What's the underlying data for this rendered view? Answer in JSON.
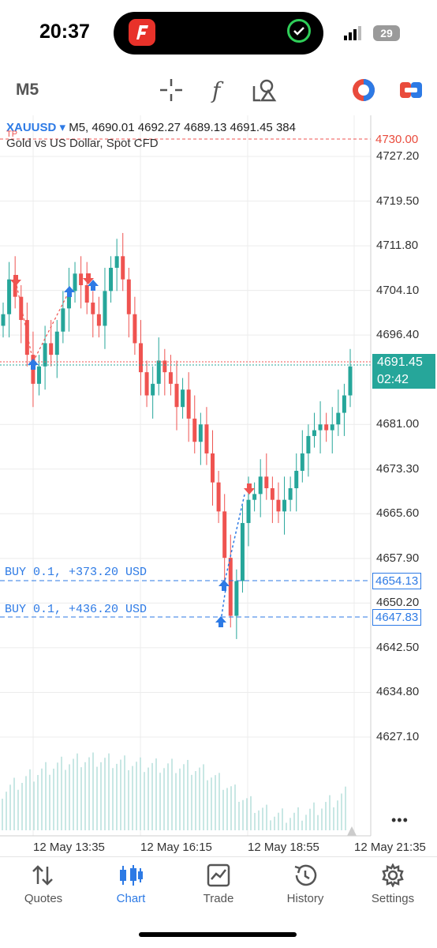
{
  "status_bar": {
    "time": "20:37",
    "battery": "29"
  },
  "toolbar": {
    "timeframe": "M5"
  },
  "chart": {
    "symbol": "XAUUSD",
    "symbol_arrow": "▾",
    "ohlc_line": "M5, 4690.01 4692.27 4689.13 4691.45 384",
    "description": "Gold vs US Dollar, Spot CFD",
    "tp_marker": "TP",
    "tp_price": "4730.00",
    "price_ticks": [
      "4727.20",
      "4719.50",
      "4711.80",
      "4704.10",
      "4696.40",
      "4681.00",
      "4673.30",
      "4665.60",
      "4657.90",
      "4650.20",
      "4642.50",
      "4634.80",
      "4627.10"
    ],
    "current_price": "4691.45",
    "countdown": "02:42",
    "positions": [
      {
        "label": "BUY 0.1, +373.20 USD",
        "price": "4654.13"
      },
      {
        "label": "BUY 0.1, +436.20 USD",
        "price": "4647.83"
      }
    ],
    "time_labels": [
      "12 May 13:35",
      "12 May 16:15",
      "12 May 18:55",
      "12 May 21:35"
    ],
    "more": "•••",
    "colors": {
      "bull": "#26a69a",
      "bear": "#ef5350",
      "buy": "#2d7ae5",
      "tp_line": "#ef5350"
    }
  },
  "chart_data": {
    "type": "candlestick",
    "symbol": "XAUUSD",
    "timeframe": "M5",
    "ylim": [
      4620,
      4732
    ],
    "close_series_approx": [
      4700,
      4706,
      4703,
      4699,
      4693,
      4688,
      4691,
      4695,
      4693,
      4697,
      4701,
      4704,
      4707,
      4705,
      4702,
      4700,
      4698,
      4704,
      4708,
      4710,
      4706,
      4700,
      4695,
      4690,
      4686,
      4688,
      4692,
      4690,
      4688,
      4684,
      4687,
      4682,
      4678,
      4681,
      4676,
      4671,
      4666,
      4658,
      4648,
      4654,
      4664,
      4668,
      4669,
      4672,
      4670,
      4668,
      4666,
      4668,
      4670,
      4673,
      4676,
      4679,
      4680,
      4681,
      4680,
      4681,
      4683,
      4686,
      4691
    ]
  },
  "nav": {
    "items": [
      {
        "label": "Quotes",
        "icon": "quotes-icon"
      },
      {
        "label": "Chart",
        "icon": "chart-icon"
      },
      {
        "label": "Trade",
        "icon": "trade-icon"
      },
      {
        "label": "History",
        "icon": "history-icon"
      },
      {
        "label": "Settings",
        "icon": "settings-icon"
      }
    ],
    "active": "Chart"
  }
}
